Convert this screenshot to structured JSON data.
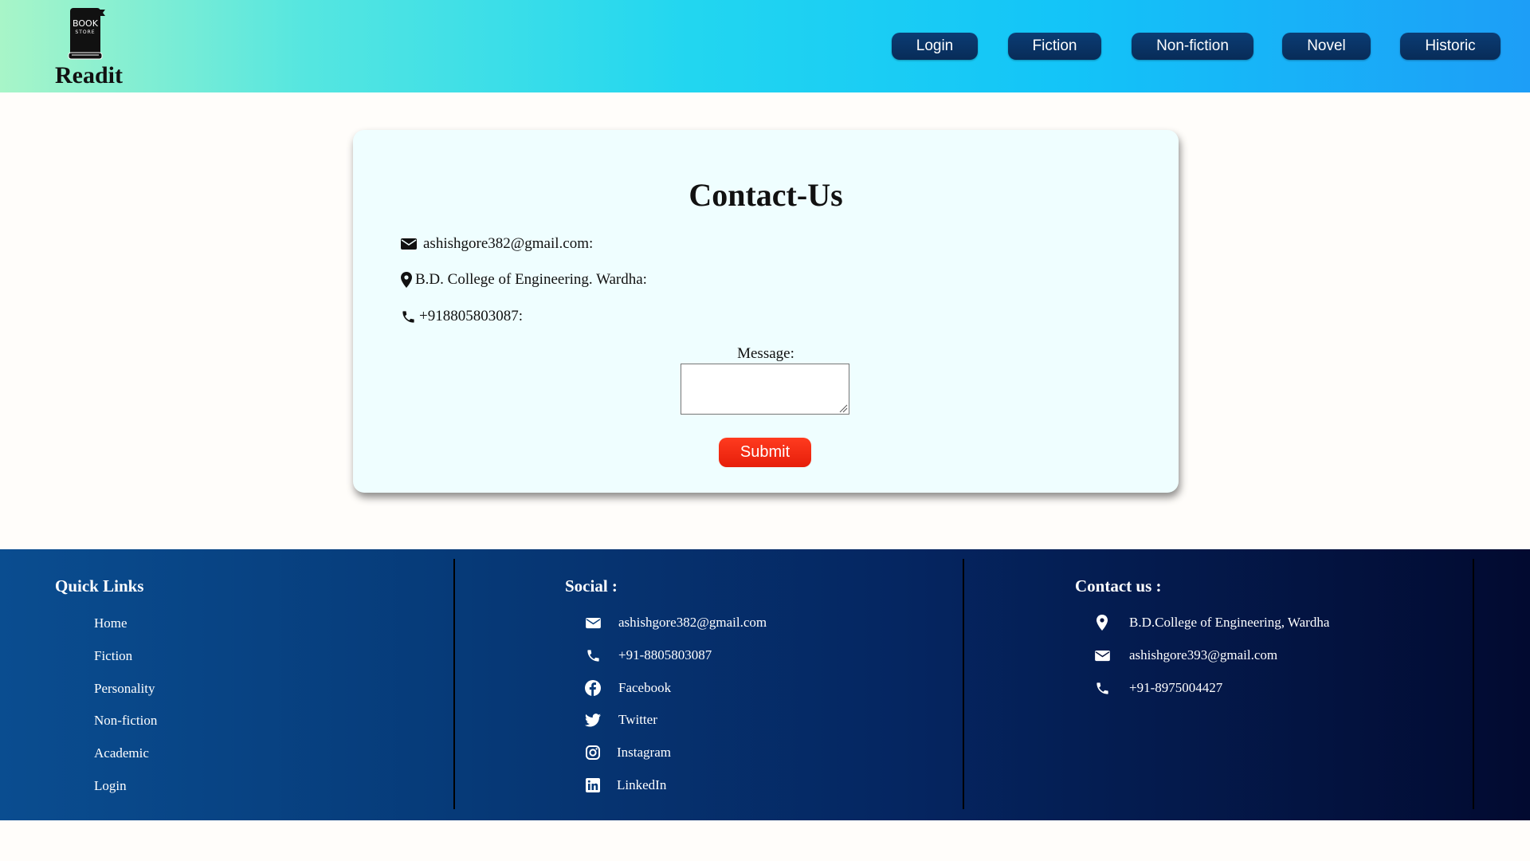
{
  "header": {
    "brand": "Readit",
    "logo_text_top": "BOOK",
    "logo_text_bottom": "STORE",
    "nav": [
      {
        "label": "Login"
      },
      {
        "label": "Fiction"
      },
      {
        "label": "Non-fiction"
      },
      {
        "label": "Novel"
      },
      {
        "label": "Historic"
      }
    ]
  },
  "contact": {
    "title": "Contact-Us",
    "email": "ashishgore382@gmail.com:",
    "address": "B.D. College of Engineering. Wardha:",
    "phone": "+918805803087:",
    "message_label": "Message:",
    "message_value": "",
    "submit_label": "Submit"
  },
  "footer": {
    "quick_links": {
      "title": "Quick Links",
      "items": [
        "Home",
        "Fiction",
        "Personality",
        "Non-fiction",
        "Academic",
        "Login"
      ]
    },
    "social": {
      "title": "Social :",
      "items": [
        {
          "icon": "envelope-icon",
          "label": "ashishgore382@gmail.com"
        },
        {
          "icon": "phone-icon",
          "label": "+91-8805803087"
        },
        {
          "icon": "facebook-icon",
          "label": "Facebook"
        },
        {
          "icon": "twitter-icon",
          "label": "Twitter"
        },
        {
          "icon": "instagram-icon",
          "label": "Instagram"
        },
        {
          "icon": "linkedin-icon",
          "label": "LinkedIn"
        }
      ]
    },
    "contact": {
      "title": "Contact us :",
      "items": [
        {
          "icon": "location-pin-icon",
          "label": "B.D.College of Engineering, Wardha"
        },
        {
          "icon": "envelope-icon",
          "label": "ashishgore393@gmail.com"
        },
        {
          "icon": "phone-icon",
          "label": "+91-8975004427"
        }
      ]
    }
  },
  "colors": {
    "nav_button": "#0b3c74",
    "submit_button": "#ff3b1f",
    "card_background": "#effeff",
    "footer_start": "#0a4d90",
    "footer_end": "#020a30"
  }
}
